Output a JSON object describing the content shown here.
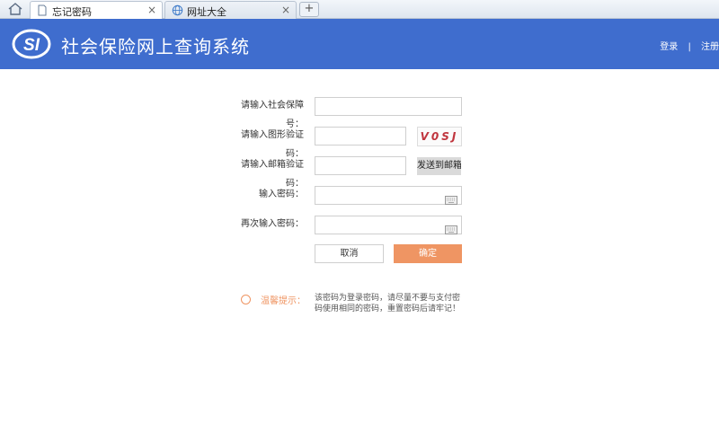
{
  "browser": {
    "tabs": [
      {
        "label": "忘记密码",
        "active": true
      },
      {
        "label": "网址大全",
        "active": false
      }
    ],
    "close_glyph": "×",
    "new_tab_glyph": "+"
  },
  "header": {
    "logo_text": "SI",
    "title": "社会保险网上查询系统",
    "login_link": "登录",
    "separator": "|",
    "register_link": "注册",
    "background_color": "#3f6dce"
  },
  "form": {
    "ssn_label": "请输入社会保障号：",
    "captcha_label": "请输入图形验证码：",
    "captcha_value": "V0SJ",
    "email_code_label": "请输入邮箱验证码：",
    "send_email_button": "发送到邮箱",
    "password_label": "输入密码：",
    "confirm_password_label": "再次输入密码：",
    "cancel_button": "取消",
    "submit_button": "确定",
    "accent_color": "#ef9563"
  },
  "tips": {
    "label": "温馨提示：",
    "text": "该密码为登录密码，请尽量不要与支付密码使用相同的密码，重置密码后请牢记！"
  }
}
